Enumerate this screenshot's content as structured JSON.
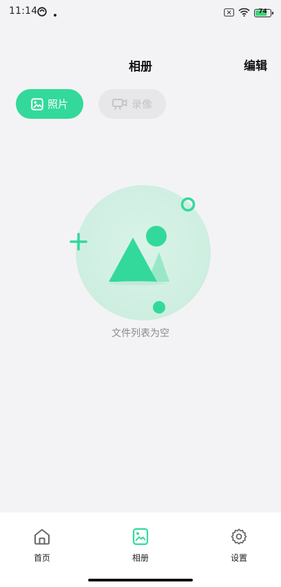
{
  "status_bar": {
    "time": "11:14",
    "battery_level": "74",
    "icons": [
      "vpn-icon",
      "dot-icon",
      "sim-off-icon",
      "wifi-icon",
      "battery-icon"
    ]
  },
  "header": {
    "title": "相册",
    "edit_label": "编辑"
  },
  "tabs": [
    {
      "label": "照片",
      "icon": "photo-icon",
      "active": true
    },
    {
      "label": "录像",
      "icon": "video-icon",
      "active": false
    }
  ],
  "empty_state": {
    "message": "文件列表为空"
  },
  "bottom_nav": [
    {
      "label": "首页",
      "icon": "home-icon",
      "active": false
    },
    {
      "label": "相册",
      "icon": "album-icon",
      "active": true
    },
    {
      "label": "设置",
      "icon": "gear-icon",
      "active": false
    }
  ],
  "colors": {
    "accent": "#33d99b",
    "background": "#f3f3f5",
    "inactive_tab_bg": "#e7e7ea",
    "inactive_tab_text": "#c4c4c8"
  }
}
